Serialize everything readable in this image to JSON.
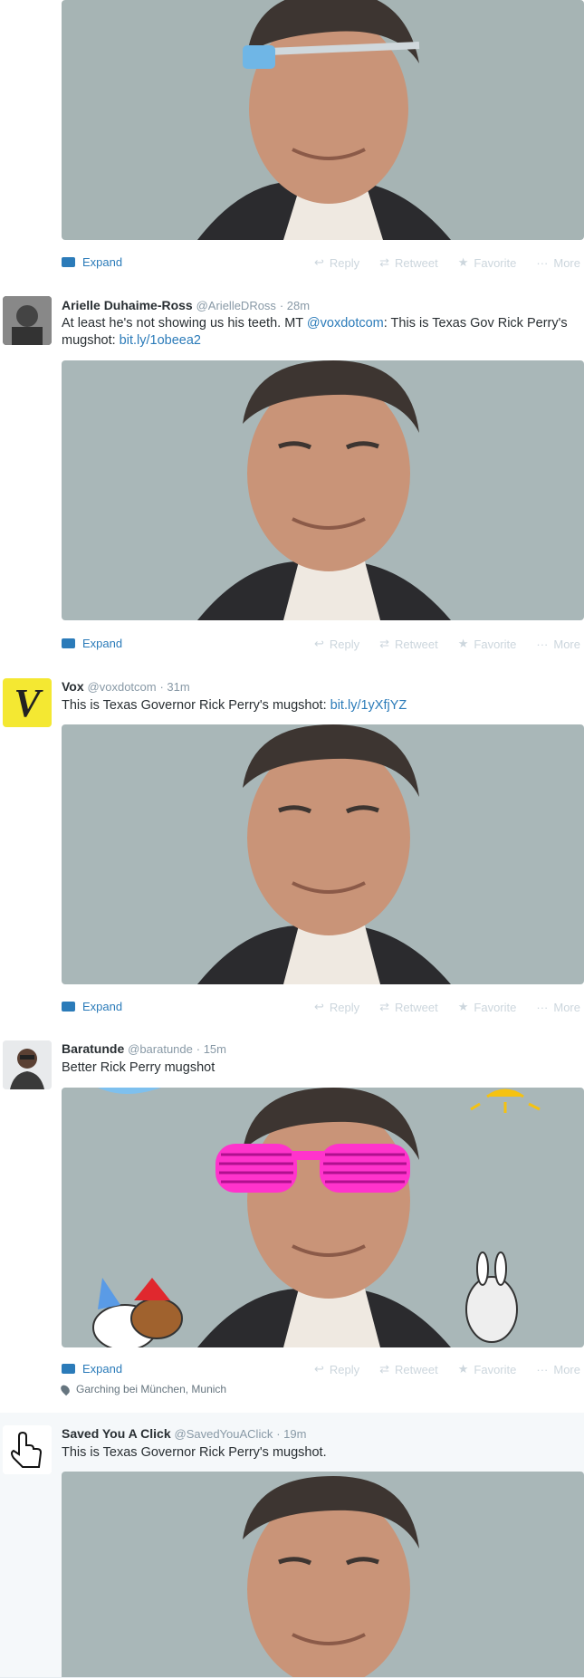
{
  "actions": {
    "expand": "Expand",
    "reply": "Reply",
    "retweet": "Retweet",
    "favorite": "Favorite",
    "more": "More"
  },
  "tweets": [
    {
      "name": "Arielle Duhaime-Ross",
      "handle": "@ArielleDRoss",
      "time": "· 28m",
      "text": "At least he's not showing us his teeth. MT ",
      "mention": "@voxdotcom",
      "text2": ": This is Texas Gov Rick Perry's mugshot: ",
      "link": "bit.ly/1obeea2"
    },
    {
      "name": "Vox",
      "handle": "@voxdotcom",
      "time": "· 31m",
      "text": "This is Texas Governor Rick Perry's mugshot: ",
      "link": "bit.ly/1yXfjYZ",
      "avatar_letter": "V",
      "avatar_color": "#f4e832"
    },
    {
      "name": "Baratunde",
      "handle": "@baratunde",
      "time": "· 15m",
      "text": "Better Rick Perry mugshot",
      "location": "Garching bei München, Munich"
    },
    {
      "name": "Saved You A Click",
      "handle": "@SavedYouAClick",
      "time": "· 19m",
      "text": "This is Texas Governor Rick Perry's mugshot."
    }
  ],
  "colors": {
    "link": "#2b7bb9",
    "photo_bg": "#a9b7b8",
    "glass_frame": "#6fb6e6",
    "party_glasses": "#ff33cc"
  }
}
